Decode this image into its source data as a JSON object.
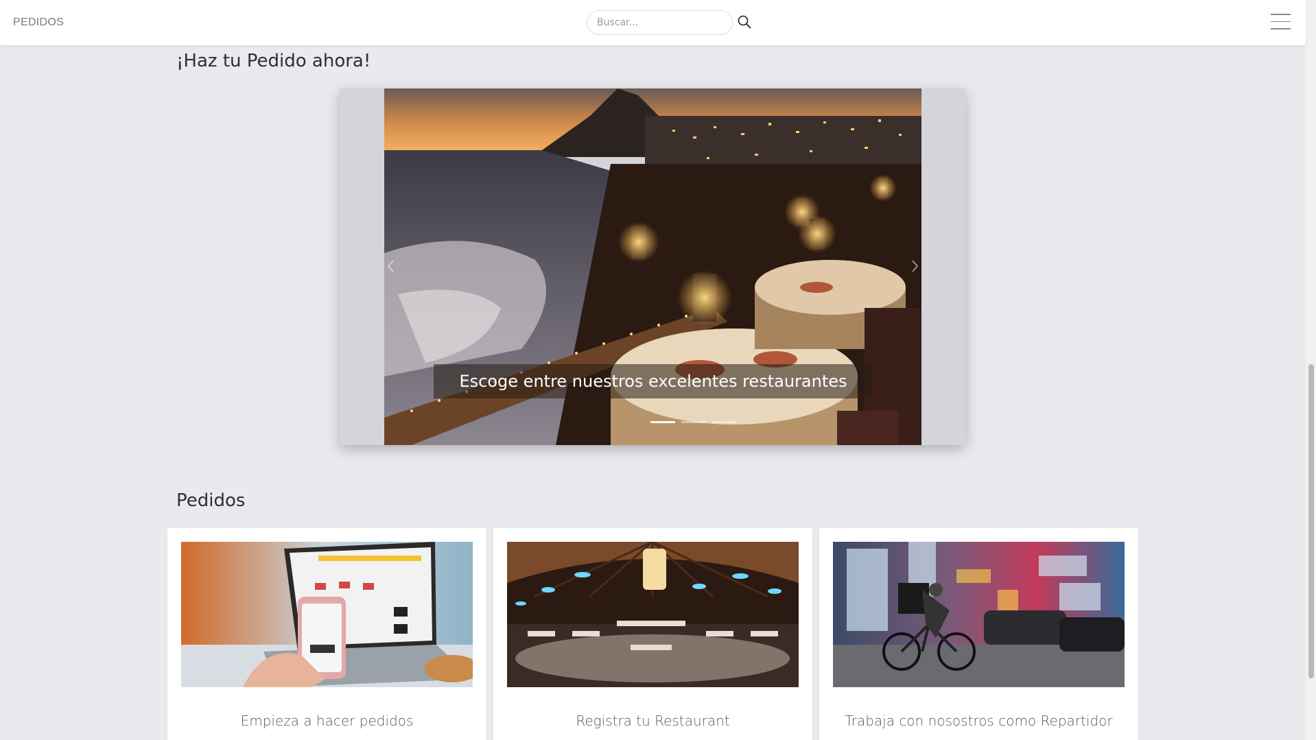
{
  "navbar": {
    "brand": "PEDIDOS",
    "search_placeholder": "Buscar...",
    "search_icon": "search-icon",
    "menu_icon": "hamburger-menu-icon"
  },
  "hero": {
    "heading": "¡Haz tu Pedido ahora!",
    "carousel": {
      "caption": "Escoge entre nuestros excelentes restaurantes",
      "slide_count": 3,
      "active_slide": 1,
      "prev_icon": "chevron-left-icon",
      "next_icon": "chevron-right-icon"
    }
  },
  "pedidos": {
    "heading": "Pedidos",
    "cards": [
      {
        "title": "Empieza a hacer pedidos"
      },
      {
        "title": "Registra tu Restaurant"
      },
      {
        "title": "Trabaja con nosostros como Repartidor"
      }
    ]
  },
  "colors": {
    "page_bg": "#e9eaee",
    "navbar_bg": "#ffffff",
    "card_bg": "#ffffff"
  }
}
